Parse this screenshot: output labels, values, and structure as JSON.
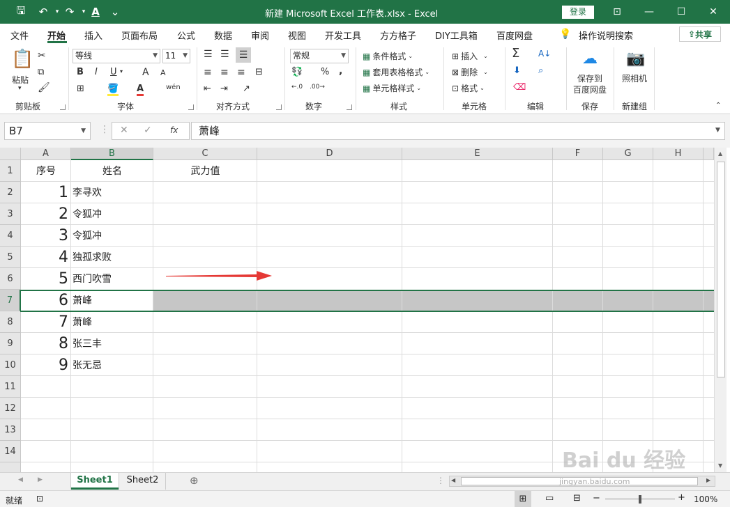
{
  "titlebar": {
    "title": "新建 Microsoft Excel 工作表.xlsx  -  Excel",
    "login": "登录",
    "qat_save": "🖫",
    "qat_undo": "↶",
    "qat_redo": "↷",
    "qat_font": "A",
    "qat_more": "⌄",
    "win_ribbon_opt": "⊡",
    "win_min": "—",
    "win_max": "☐",
    "win_close": "✕"
  },
  "tabs": [
    "文件",
    "开始",
    "插入",
    "页面布局",
    "公式",
    "数据",
    "审阅",
    "视图",
    "开发工具",
    "方方格子",
    "DIY工具箱",
    "百度网盘"
  ],
  "tell_me": "操作说明搜索",
  "share": "共享",
  "ribbon": {
    "clipboard": {
      "paste": "粘贴",
      "label": "剪贴板"
    },
    "font": {
      "name": "等线",
      "size": "11",
      "label": "字体",
      "bold": "B",
      "italic": "I",
      "underline": "U",
      "grow": "A",
      "shrink": "A",
      "wen": "wén"
    },
    "align": {
      "label": "对齐方式"
    },
    "number": {
      "format": "常规",
      "label": "数字",
      "percent": "%",
      "comma": ","
    },
    "styles": {
      "cond": "条件格式",
      "table": "套用表格格式",
      "cell": "单元格样式",
      "label": "样式"
    },
    "cells": {
      "insert": "插入",
      "delete": "删除",
      "format": "格式",
      "label": "单元格"
    },
    "editing": {
      "label": "编辑",
      "sum": "Σ"
    },
    "save": {
      "line1": "保存到",
      "line2": "百度网盘",
      "label": "保存"
    },
    "newgroup": {
      "camera": "照相机",
      "label": "新建组"
    }
  },
  "formula": {
    "namebox": "B7",
    "cancel": "✕",
    "enter": "✓",
    "fx": "fx",
    "content": "萧峰"
  },
  "columns": [
    "A",
    "B",
    "C",
    "D",
    "E",
    "F",
    "G",
    "H"
  ],
  "rows": [
    "1",
    "2",
    "3",
    "4",
    "5",
    "6",
    "7",
    "8",
    "9",
    "10",
    "11",
    "12",
    "13",
    "14"
  ],
  "cells": {
    "header": {
      "a": "序号",
      "b": "姓名",
      "c": "武力值"
    },
    "data": [
      {
        "num": "1",
        "name": "李寻欢"
      },
      {
        "num": "2",
        "name": "令狐冲"
      },
      {
        "num": "3",
        "name": "令狐冲"
      },
      {
        "num": "4",
        "name": "独孤求败"
      },
      {
        "num": "5",
        "name": "西门吹雪"
      },
      {
        "num": "6",
        "name": "萧峰"
      },
      {
        "num": "7",
        "name": "萧峰"
      },
      {
        "num": "8",
        "name": "张三丰"
      },
      {
        "num": "9",
        "name": "张无忌"
      }
    ]
  },
  "sheets": [
    "Sheet1",
    "Sheet2"
  ],
  "add_sheet": "⊕",
  "status": {
    "ready": "就绪",
    "zoom": "100%"
  },
  "watermark": {
    "brand": "Bai du 经验",
    "url": "jingyan.baidu.com"
  },
  "colors": {
    "excel_green": "#217346",
    "arrow_red": "#e53935"
  }
}
